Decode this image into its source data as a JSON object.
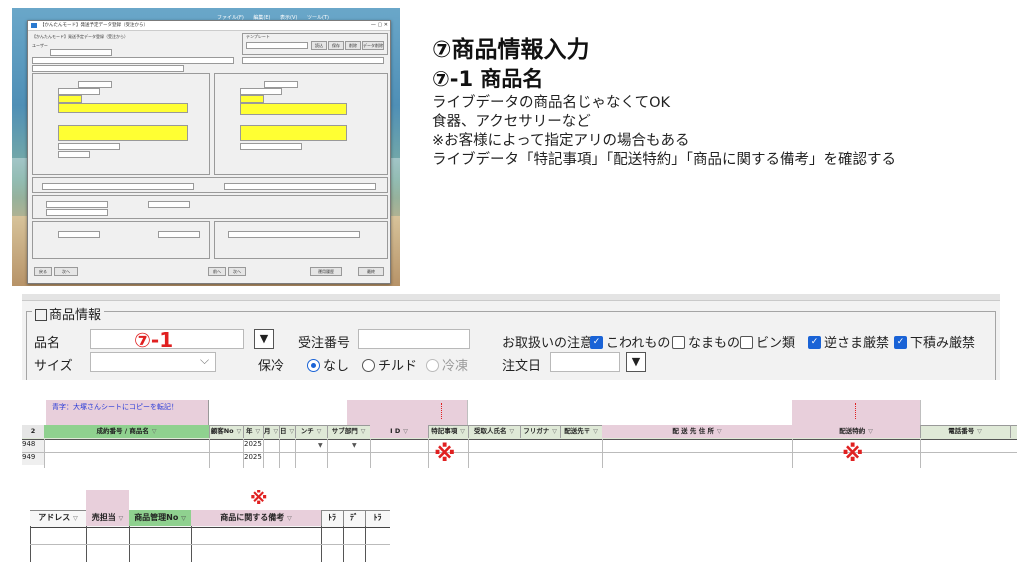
{
  "colors": {
    "accent_red": "#e02020",
    "yellow_field": "#ffff33",
    "pink_header": "#e8cfdb",
    "green_header": "#8fd18f",
    "checkbox_blue": "#1a63d6"
  },
  "screenshot": {
    "desktop_menu": [
      "ファイル(F)",
      "編集(E)",
      "表示(V)",
      "ツール(T)"
    ],
    "window_title": "【かんたんモード】発送予定データ登録（受注から）",
    "mode_label": "【かんたんモード】発送予定データ登録（受注から）",
    "template_label": "テンプレート",
    "user_label": "ユーザー",
    "buttons": [
      "読込",
      "保存",
      "削除",
      "データ削除",
      "戻る",
      "次へ",
      "前へ",
      "運用履歴",
      "最終"
    ]
  },
  "heading": {
    "title": "⑦商品情報入力",
    "subtitle": "⑦-1 商品名",
    "lines": [
      "ライブデータの商品名じゃなくてOK",
      "食器、アクセサリーなど",
      "※お客様によって指定アリの場合もある",
      "ライブデータ「特記事項」「配送特約」「商品に関する備考」を確認する"
    ]
  },
  "form": {
    "legend": "商品情報",
    "product_name_label": "品名",
    "product_name_marker": "⑦-1",
    "order_no_label": "受注番号",
    "handling_label": "お取扱いの注意",
    "handling_options": [
      {
        "label": "こわれもの",
        "checked": true
      },
      {
        "label": "なまもの",
        "checked": false
      },
      {
        "label": "ビン類",
        "checked": false
      },
      {
        "label": "逆さま厳禁",
        "checked": true
      },
      {
        "label": "下積み厳禁",
        "checked": true
      }
    ],
    "size_label": "サイズ",
    "cool_label": "保冷",
    "cool_options": [
      {
        "label": "なし",
        "selected": true
      },
      {
        "label": "チルド",
        "selected": false
      },
      {
        "label": "冷凍",
        "selected": false,
        "disabled": true
      }
    ],
    "order_date_label": "注文日"
  },
  "sheet1": {
    "note": "青字：大塚さんシートにコピーを転記！",
    "row_header": "2",
    "headers": [
      "成約番号 / 商品名",
      "顧客No",
      "年",
      "月",
      "日",
      "ンチ",
      "サブ部門",
      "I D",
      "特記事項",
      "受取人氏名",
      "フリガナ",
      "配送先〒",
      "配 送 先 住 所",
      "配送特約",
      "電話番号"
    ],
    "rows": [
      {
        "num": "948",
        "year": "2025"
      },
      {
        "num": "949",
        "year": "2025"
      }
    ],
    "mark": "※"
  },
  "sheet2": {
    "headers": [
      "アドレス",
      "売担当",
      "商品管理No",
      "商品に関する備考",
      "ﾄﾗ",
      "ﾃﾞ",
      "ﾄﾗ"
    ],
    "mark": "※"
  }
}
